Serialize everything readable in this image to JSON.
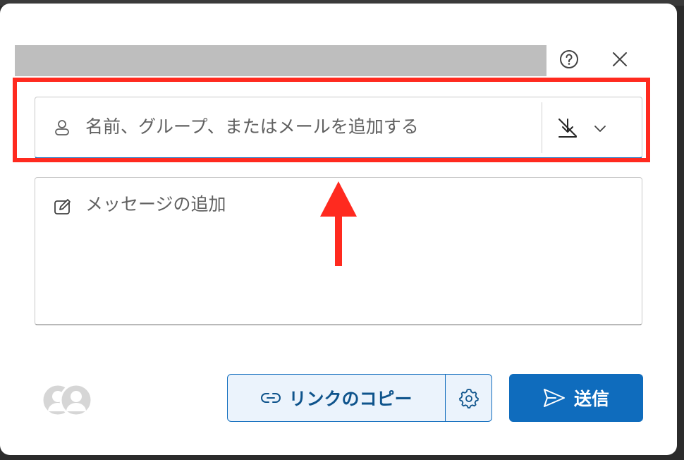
{
  "dialog": {
    "help_icon": "question-circle-icon",
    "close_icon": "close-icon"
  },
  "recipients": {
    "icon": "person-icon",
    "placeholder": "名前、グループ、またはメールを追加する",
    "permission_icon": "no-download-icon",
    "dropdown_icon": "chevron-down-icon"
  },
  "message": {
    "icon": "edit-icon",
    "placeholder": "メッセージの追加"
  },
  "footer": {
    "avatars_icon": "people-icon",
    "copy_link_label": "リンクのコピー",
    "copy_link_icon": "link-icon",
    "settings_icon": "gear-icon",
    "send_label": "送信",
    "send_icon": "send-icon"
  },
  "colors": {
    "accent": "#0f6cbd",
    "annotation": "#ff2a1f"
  }
}
